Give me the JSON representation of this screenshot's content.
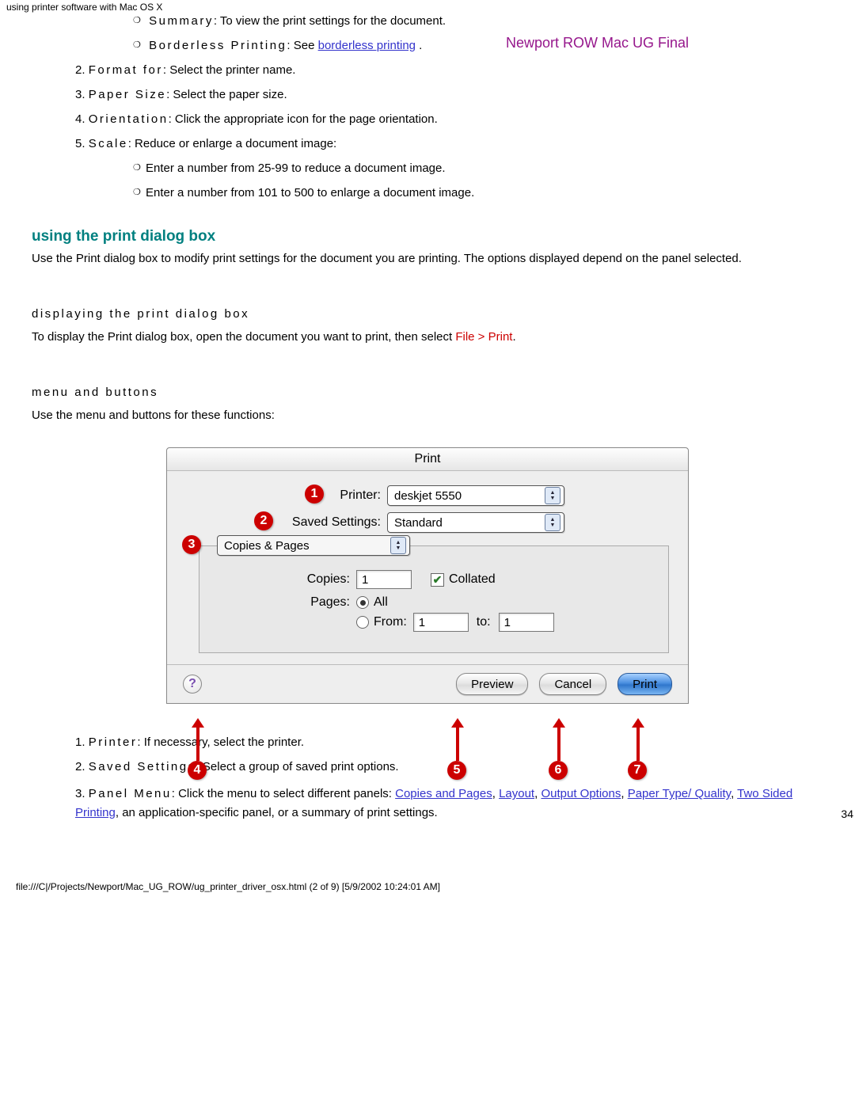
{
  "header_path": "using printer software with Mac OS X",
  "watermark": "Newport ROW Mac UG Final",
  "top_bullets": [
    {
      "label": "Summary",
      "rest": ": To view the print settings for the document."
    },
    {
      "label": "Borderless Printing",
      "rest": ": See ",
      "link": "borderless printing",
      "after": " ."
    }
  ],
  "numbered_top": [
    {
      "n": "2.",
      "label": "Format for",
      "rest": ": Select the printer name."
    },
    {
      "n": "3.",
      "label": "Paper Size",
      "rest": ": Select the paper size."
    },
    {
      "n": "4.",
      "label": "Orientation",
      "rest": ": Click the appropriate icon for the page orientation."
    },
    {
      "n": "5.",
      "label": "Scale",
      "rest": ": Reduce or enlarge a document image:"
    }
  ],
  "scale_bullets": [
    "Enter a number from 25-99 to reduce a document image.",
    "Enter a number from 101 to 500 to enlarge a document image."
  ],
  "section_title": "using the print dialog box",
  "section_intro": "Use the Print dialog box to modify print settings for the document you are printing. The options displayed depend on the panel selected.",
  "sub1_title": "displaying the print dialog box",
  "sub1_text_pre": "To display the Print dialog box, open the document you want to print, then select ",
  "sub1_file": "File",
  "sub1_gt": " > ",
  "sub1_print": "Print",
  "sub1_after": ".",
  "sub2_title": "menu and buttons",
  "sub2_text": "Use the menu and buttons for these functions:",
  "dialog": {
    "title": "Print",
    "printer_label": "Printer:",
    "printer_value": "deskjet 5550",
    "saved_label": "Saved Settings:",
    "saved_value": "Standard",
    "panel_value": "Copies & Pages",
    "copies_label": "Copies:",
    "copies_value": "1",
    "collated": "Collated",
    "pages_label": "Pages:",
    "all": "All",
    "from": "From:",
    "from_val": "1",
    "to": "to:",
    "to_val": "1",
    "preview": "Preview",
    "cancel": "Cancel",
    "print": "Print",
    "help": "?"
  },
  "callouts": {
    "c1": "1",
    "c2": "2",
    "c3": "3",
    "c4": "4",
    "c5": "5",
    "c6": "6",
    "c7": "7"
  },
  "numbered_bottom": [
    {
      "n": "1.",
      "label": "Printer",
      "rest": ": If necessary, select the printer."
    },
    {
      "n": "2.",
      "label": "Saved Settings",
      "rest": ": Select a group of saved print options."
    },
    {
      "n": "3.",
      "label": "Panel Menu",
      "rest": ": Click the menu to select different panels: ",
      "links": [
        "Copies and Pages",
        "Layout",
        "Output Options",
        "Paper Type/ Quality",
        "Two Sided Printing"
      ],
      "tail": ", an application-specific panel, or a summary of print settings."
    }
  ],
  "page_number": "34",
  "footer": "file:///C|/Projects/Newport/Mac_UG_ROW/ug_printer_driver_osx.html (2 of 9) [5/9/2002 10:24:01 AM]"
}
